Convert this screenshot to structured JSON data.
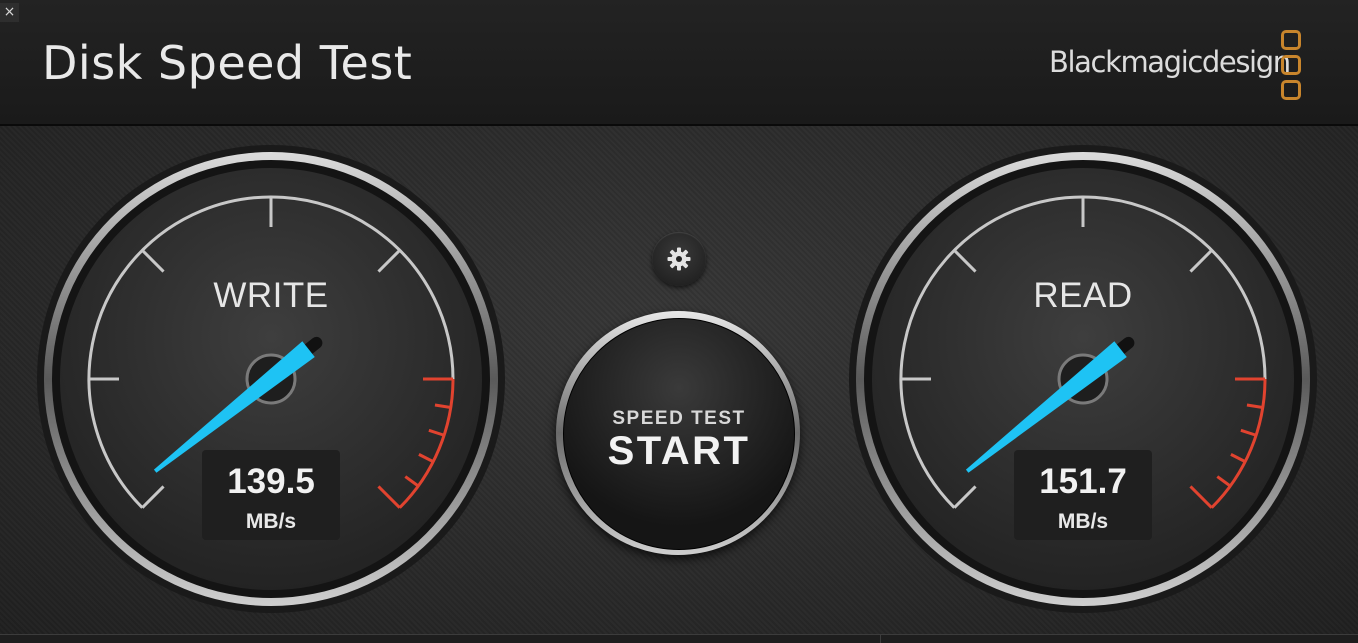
{
  "window": {
    "close_glyph": "×"
  },
  "header": {
    "title": "Disk Speed Test",
    "brand": "Blackmagicdesign",
    "brand_logo_color": "#c8852c"
  },
  "write_gauge": {
    "label": "WRITE",
    "value": "139.5",
    "unit": "MB/s"
  },
  "read_gauge": {
    "label": "READ",
    "value": "151.7",
    "unit": "MB/s"
  },
  "start_button": {
    "subtitle": "SPEED TEST",
    "label": "START"
  },
  "settings": {
    "icon": "gear-icon"
  },
  "colors": {
    "needle": "#1ec3f4",
    "redline": "#e1432f",
    "ticks": "#c8c8c8"
  }
}
